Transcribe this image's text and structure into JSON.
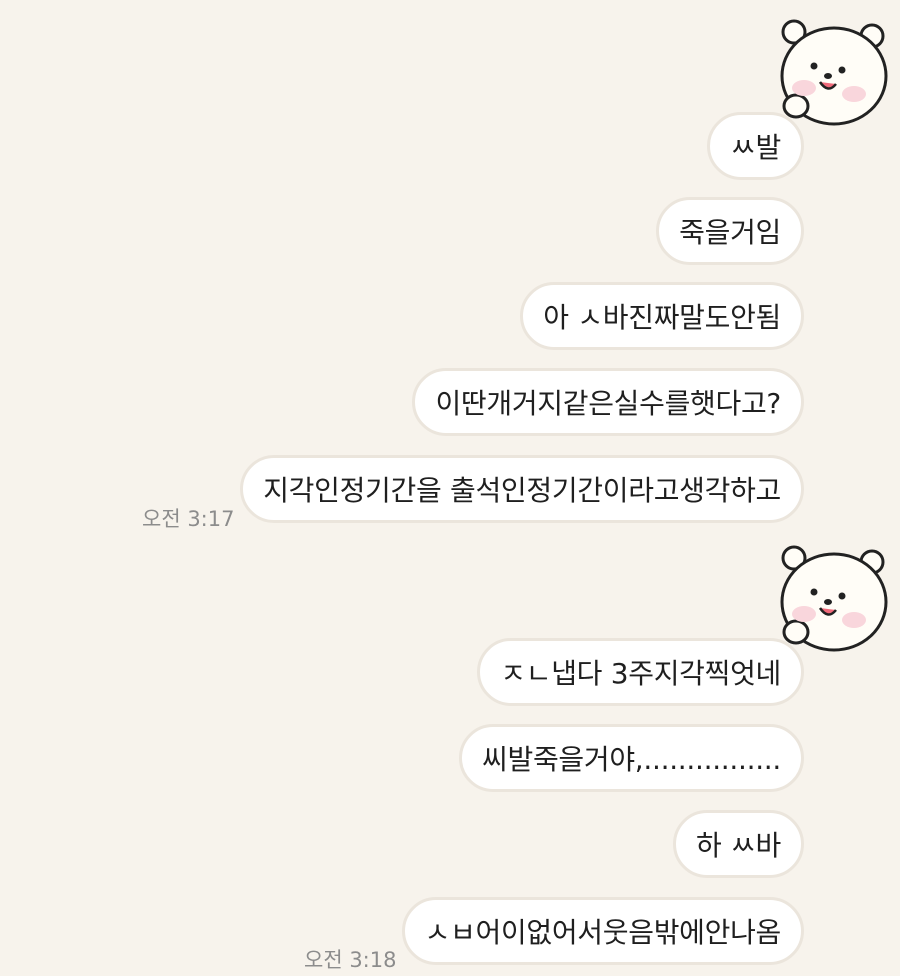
{
  "chat": {
    "group1": {
      "messages": [
        "ㅆ발",
        "죽을거임",
        "아 ㅅ바진짜말도안됨",
        "이딴개거지같은실수를햇다고?",
        "지각인정기간을 출석인정기간이라고생각하고"
      ],
      "time": "오전 3:17"
    },
    "group2": {
      "messages": [
        "ㅈㄴ냅다 3주지각찍엇네",
        "씨발죽을거야,................",
        "하 ㅆ바",
        "ㅅㅂ어이없어서웃음밖에안나옴"
      ],
      "time": "오전 3:18"
    }
  },
  "icons": {
    "sender_avatar": "white-bear-sticker-avatar"
  },
  "colors": {
    "background": "#f7f3ec",
    "bubble": "#ffffff",
    "bubble_border": "#ebe5dc",
    "text": "#1f1f1f",
    "timestamp": "#8c8c8c"
  }
}
